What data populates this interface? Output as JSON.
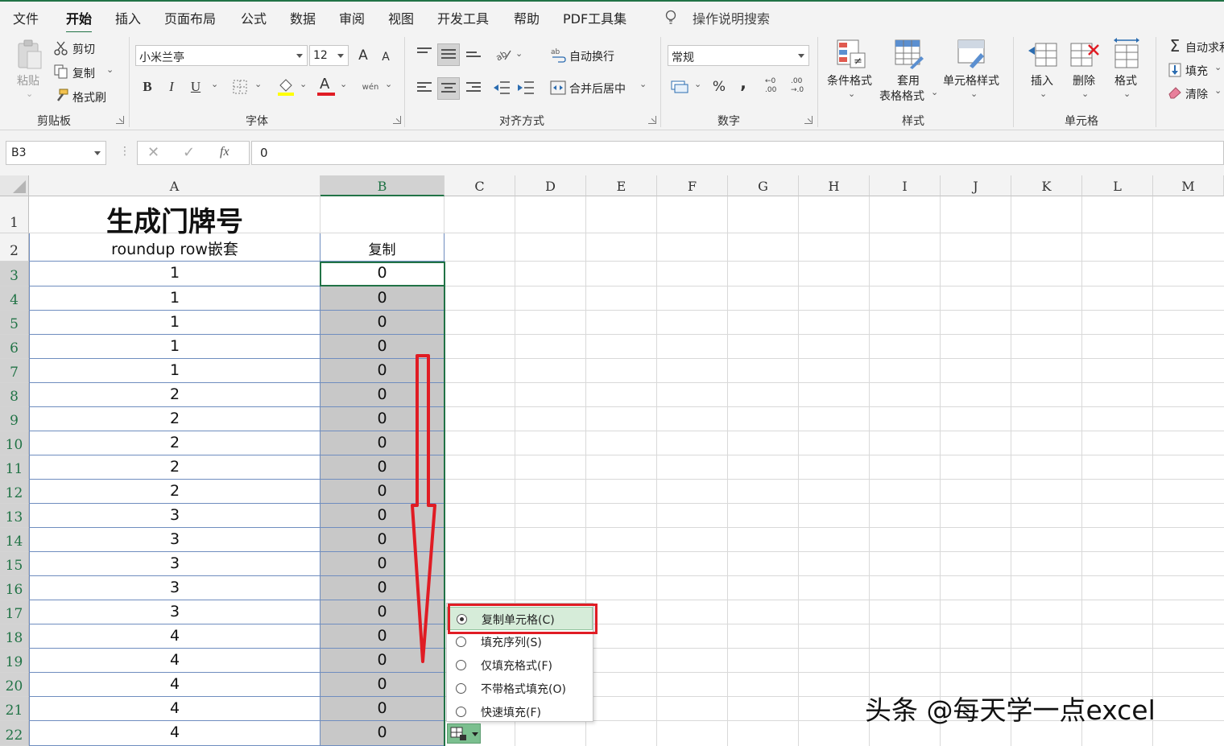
{
  "ribbon_tabs": [
    "文件",
    "开始",
    "插入",
    "页面布局",
    "公式",
    "数据",
    "审阅",
    "视图",
    "开发工具",
    "帮助",
    "PDF工具集"
  ],
  "active_tab": "开始",
  "tell_me": "操作说明搜索",
  "clipboard": {
    "paste": "粘贴",
    "cut": "剪切",
    "copy": "复制",
    "format_painter": "格式刷",
    "label": "剪贴板"
  },
  "font": {
    "name": "小米兰亭",
    "size": "12",
    "label": "字体",
    "bold": "B",
    "italic": "I",
    "underline": "U",
    "grow": "A",
    "shrink": "A",
    "font_color_glyph": "A",
    "phonetic": "wén"
  },
  "alignment": {
    "wrap_text": "自动换行",
    "merge_center": "合并后居中",
    "label": "对齐方式"
  },
  "number": {
    "format": "常规",
    "percent": "%",
    "comma": ",",
    "inc_decimal_top": "←0",
    "inc_decimal_bottom": ".00",
    "dec_decimal_top": ".00",
    "dec_decimal_bottom": "→.0",
    "label": "数字"
  },
  "styles": {
    "conditional": "条件格式",
    "table_line1": "套用",
    "table_line2": "表格格式",
    "cell_styles": "单元格样式",
    "label": "样式"
  },
  "cells": {
    "insert": "插入",
    "delete": "删除",
    "format": "格式",
    "label": "单元格"
  },
  "editing": {
    "autosum": "自动求和",
    "fill": "填充",
    "clear": "清除"
  },
  "formula_bar": {
    "name_box": "B3",
    "value": "0",
    "fx": "fx"
  },
  "columns": [
    "A",
    "B",
    "C",
    "D",
    "E",
    "F",
    "G",
    "H",
    "I",
    "J",
    "K",
    "L",
    "M"
  ],
  "rows": [
    "1",
    "2",
    "3",
    "4",
    "5",
    "6",
    "7",
    "8",
    "9",
    "10",
    "11",
    "12",
    "13",
    "14",
    "15",
    "16",
    "17",
    "18",
    "19",
    "20",
    "21",
    "22"
  ],
  "sheet": {
    "title": "生成门牌号",
    "header_a": "roundup  row嵌套",
    "header_b": "复制",
    "col_a": [
      "1",
      "1",
      "1",
      "1",
      "1",
      "2",
      "2",
      "2",
      "2",
      "2",
      "3",
      "3",
      "3",
      "3",
      "3",
      "4",
      "4",
      "4",
      "4",
      "4"
    ],
    "col_b": [
      "0",
      "0",
      "0",
      "0",
      "0",
      "0",
      "0",
      "0",
      "0",
      "0",
      "0",
      "0",
      "0",
      "0",
      "0",
      "0",
      "0",
      "0",
      "0",
      "0"
    ]
  },
  "autofill_menu": [
    "复制单元格(C)",
    "填充序列(S)",
    "仅填充格式(F)",
    "不带格式填充(O)",
    "快速填充(F)"
  ],
  "autofill_selected": "复制单元格(C)",
  "watermark": "头条 @每天学一点excel",
  "colors": {
    "accent": "#217346",
    "annotation_red": "#e01c24",
    "selection_fill": "#c8c8c8"
  }
}
